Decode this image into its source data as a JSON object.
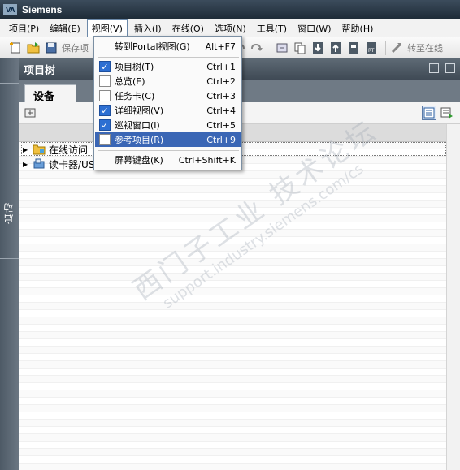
{
  "window": {
    "title": "Siemens",
    "logo_text": "VA"
  },
  "menubar": {
    "items": [
      "项目(P)",
      "编辑(E)",
      "视图(V)",
      "插入(I)",
      "在线(O)",
      "选项(N)",
      "工具(T)",
      "窗口(W)",
      "帮助(H)"
    ],
    "open_index": 2
  },
  "toolbar": {
    "save_project_label": "保存项",
    "go_online_label": "转至在线"
  },
  "side_strip": {
    "label": "启动"
  },
  "panel": {
    "title": "项目树",
    "tab": "设备"
  },
  "tree": {
    "nodes": [
      {
        "label": "在线访问",
        "icon": "folder-icon"
      },
      {
        "label": "读卡器/US",
        "icon": "card-reader-icon"
      }
    ]
  },
  "view_menu": {
    "items": [
      {
        "label": "转到Portal视图(G)",
        "shortcut": "Alt+F7",
        "checkbox": null
      },
      {
        "label": "项目树(T)",
        "shortcut": "Ctrl+1",
        "checkbox": true
      },
      {
        "label": "总览(E)",
        "shortcut": "Ctrl+2",
        "checkbox": false
      },
      {
        "label": "任务卡(C)",
        "shortcut": "Ctrl+3",
        "checkbox": false
      },
      {
        "label": "详细视图(V)",
        "shortcut": "Ctrl+4",
        "checkbox": true
      },
      {
        "label": "巡视窗口(I)",
        "shortcut": "Ctrl+5",
        "checkbox": true
      },
      {
        "label": "参考项目(R)",
        "shortcut": "Ctrl+9",
        "checkbox": false,
        "highlighted": true
      },
      {
        "label": "屏幕键盘(K)",
        "shortcut": "Ctrl+Shift+K",
        "checkbox": null
      }
    ]
  },
  "watermark": {
    "line1": "西门子工业 技术论坛",
    "line2": "support.industry.siemens.com/cs"
  },
  "colors": {
    "highlight": "#3a66b5",
    "checkbox_on": "#2d6fd2",
    "titlebar": "#2a3846"
  }
}
